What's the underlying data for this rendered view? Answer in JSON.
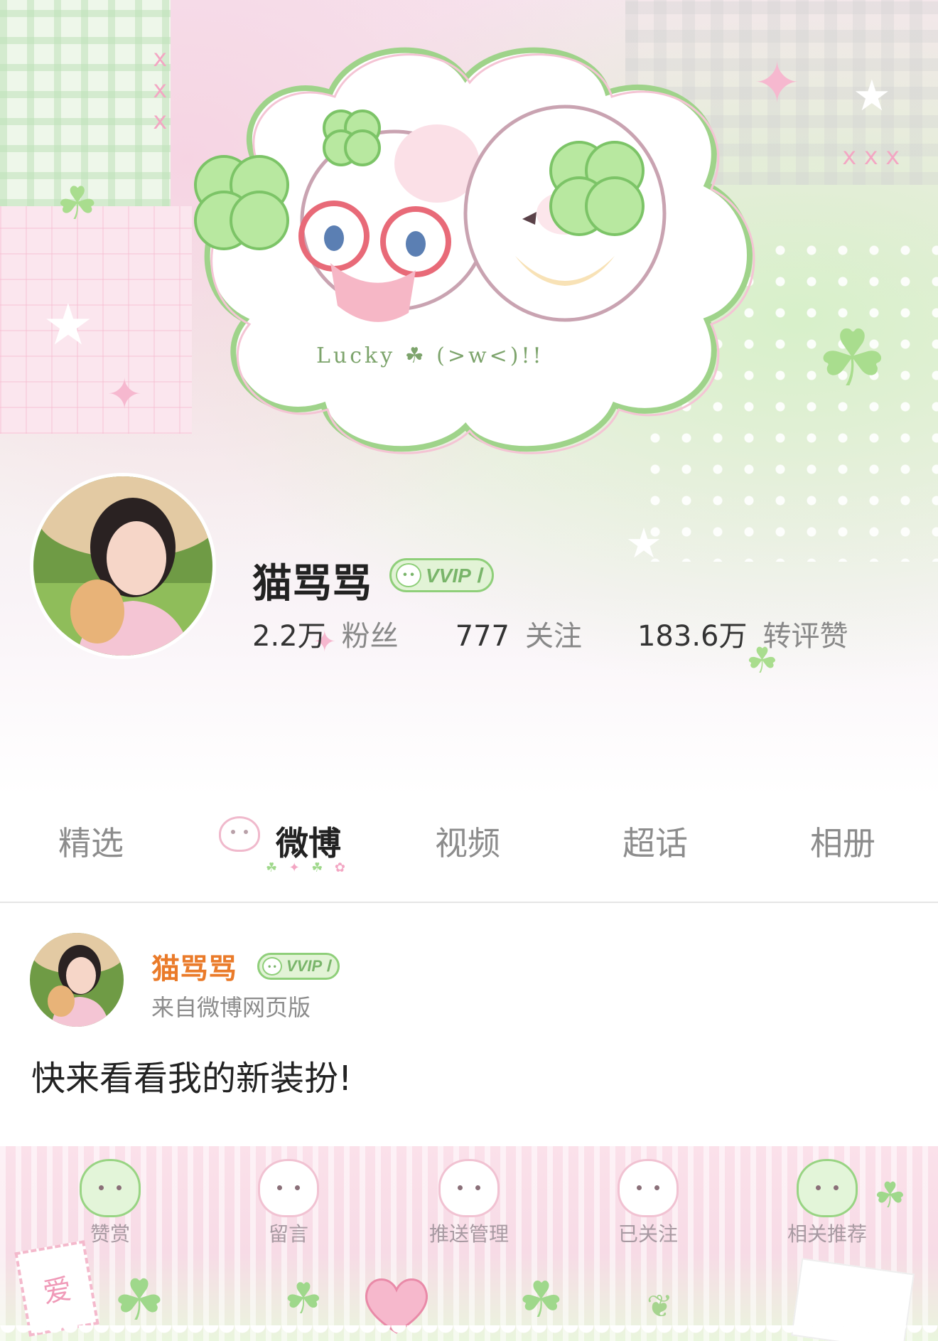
{
  "profile": {
    "name": "猫骂骂",
    "vip_label": "VVIP Ⅰ",
    "cover_text": "Lucky ☘ (>w<)!!",
    "stats": [
      {
        "num": "2.2万",
        "label": "粉丝"
      },
      {
        "num": "777",
        "label": "关注"
      },
      {
        "num": "183.6万",
        "label": "转评赞"
      }
    ]
  },
  "tabs": [
    "精选",
    "微博",
    "视频",
    "超话",
    "相册"
  ],
  "active_tab": "微博",
  "post": {
    "author": "猫骂骂",
    "vip_label": "VVIP Ⅰ",
    "source": "来自微博网页版",
    "text": "快来看看我的新装扮!"
  },
  "bottom_bar": [
    "赞赏",
    "留言",
    "推送管理",
    "已关注",
    "相关推荐"
  ],
  "decor": {
    "stamp_text": "爱"
  },
  "colors": {
    "author_orange": "#ea7b2a",
    "vip_green": "#8fcf7a",
    "accent_pink": "#f6b8cf"
  }
}
